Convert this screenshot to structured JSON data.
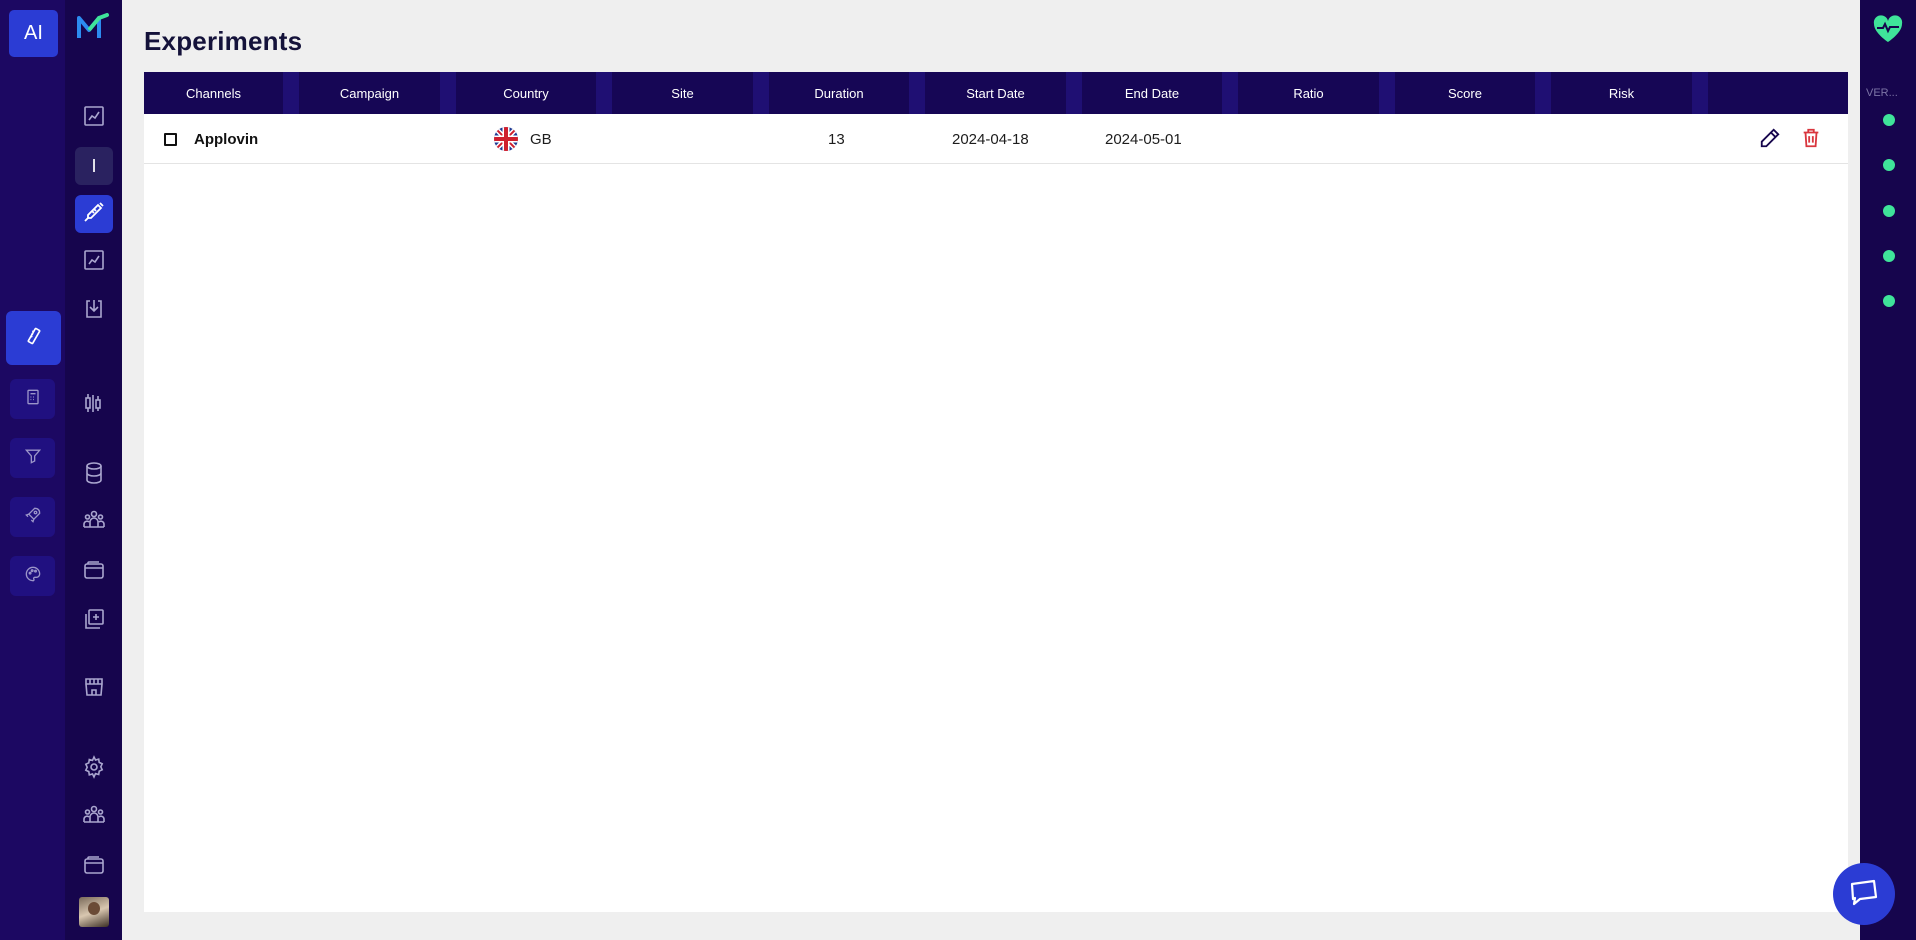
{
  "app": {
    "ai_badge_label": "AI",
    "rail_letter": "I",
    "version_label": "VER..."
  },
  "page": {
    "title": "Experiments"
  },
  "table": {
    "columns": [
      "Channels",
      "Campaign",
      "Country",
      "Site",
      "Duration",
      "Start Date",
      "End Date",
      "Ratio",
      "Score",
      "Risk"
    ],
    "rows": [
      {
        "channel": "Applovin",
        "campaign": "",
        "country": "GB",
        "site": "",
        "duration": "13",
        "start_date": "2024-04-18",
        "end_date": "2024-05-01",
        "ratio": "",
        "score": "",
        "risk": ""
      }
    ]
  },
  "icons": {
    "left_rail": [
      "ruler-icon",
      "calculator-icon",
      "funnel-icon",
      "rocket-icon",
      "palette-icon"
    ],
    "second_rail": [
      "chart-icon",
      "letter-i",
      "syringe-icon",
      "chart-icon",
      "download-icon",
      "candlestick-icon",
      "database-icon",
      "team-icon",
      "wallet-icon",
      "add-copy-icon",
      "store-icon",
      "gear-icon",
      "team-icon",
      "wallet-icon",
      "avatar"
    ],
    "row_actions": [
      "edit-icon",
      "trash-icon"
    ]
  },
  "colors": {
    "sidebar_dark": "#16054d",
    "sidebar_darker": "#1c0862",
    "accent_blue": "#2b3cd4",
    "table_header": "#160655",
    "status_green": "#3fe49a",
    "delete_red": "#d9363e"
  }
}
